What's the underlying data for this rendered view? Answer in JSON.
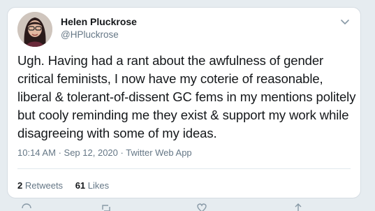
{
  "tweet": {
    "author_name": "Helen Pluckrose",
    "author_handle": "@HPluckrose",
    "text": "Ugh. Having had a rant about the awfulness of gender critical feminists, I now have my coterie of reasonable, liberal & tolerant-of-dissent GC fems in my mentions politely but cooly reminding me they exist & support my work while disagreeing with some of my ideas.",
    "time": "10:14 AM",
    "separator": "·",
    "date": "Sep 12, 2020",
    "source": "Twitter Web App",
    "retweets_count": "2",
    "retweets_label": "Retweets",
    "likes_count": "61",
    "likes_label": "Likes"
  },
  "icons": {
    "menu": "chevron-down-icon",
    "reply": "reply-icon",
    "retweet": "retweet-icon",
    "like": "heart-icon",
    "share": "share-icon"
  },
  "colors": {
    "background": "#e6ecf0",
    "card": "#ffffff",
    "text_primary": "#14171a",
    "text_secondary": "#657786"
  }
}
